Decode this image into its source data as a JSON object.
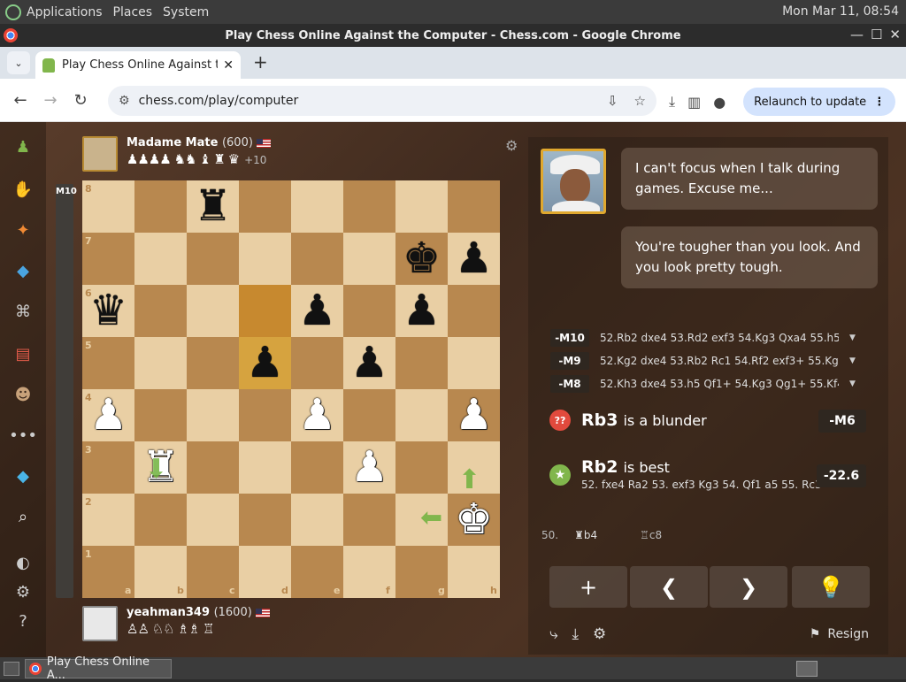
{
  "desktop": {
    "menus": [
      "Applications",
      "Places",
      "System"
    ],
    "clock": "Mon Mar 11, 08:54"
  },
  "window": {
    "title": "Play Chess Online Against the Computer - Chess.com - Google Chrome"
  },
  "browser": {
    "tab_title": "Play Chess Online Against th",
    "tab_close": "✕",
    "new_tab": "+",
    "url": "chess.com/play/computer",
    "relaunch_label": "Relaunch to update"
  },
  "top_player": {
    "name": "Madame Mate",
    "rating": "(600)",
    "captured": "♟♟♟♟ ♞♞ ♝ ♜ ♛",
    "advantage": "+10"
  },
  "bottom_player": {
    "name": "yeahman349",
    "rating": "(1600)",
    "captured": "♙♙ ♘♘ ♗♗ ♖"
  },
  "eval_bar": {
    "label": "M10"
  },
  "board": {
    "files": [
      "a",
      "b",
      "c",
      "d",
      "e",
      "f",
      "g",
      "h"
    ],
    "ranks": [
      "8",
      "7",
      "6",
      "5",
      "4",
      "3",
      "2",
      "1"
    ],
    "highlight_squares": [
      "d6",
      "d5"
    ],
    "pieces": [
      {
        "sq": "c8",
        "glyph": "♜",
        "color": "black"
      },
      {
        "sq": "g7",
        "glyph": "♚",
        "color": "black"
      },
      {
        "sq": "h7",
        "glyph": "♟",
        "color": "black"
      },
      {
        "sq": "a6",
        "glyph": "♛",
        "color": "black"
      },
      {
        "sq": "e6",
        "glyph": "♟",
        "color": "black"
      },
      {
        "sq": "g6",
        "glyph": "♟",
        "color": "black"
      },
      {
        "sq": "d5",
        "glyph": "♟",
        "color": "black"
      },
      {
        "sq": "f5",
        "glyph": "♟",
        "color": "black"
      },
      {
        "sq": "a4",
        "glyph": "♟",
        "color": "white"
      },
      {
        "sq": "e4",
        "glyph": "♟",
        "color": "white"
      },
      {
        "sq": "h4",
        "glyph": "♟",
        "color": "white"
      },
      {
        "sq": "b3",
        "glyph": "♜",
        "color": "white"
      },
      {
        "sq": "f3",
        "glyph": "♟",
        "color": "white"
      },
      {
        "sq": "h2",
        "glyph": "♚",
        "color": "white"
      }
    ]
  },
  "chat": {
    "message_1": "I can't focus when I talk during games. Excuse me...",
    "message_2": "You're tougher than you look. And you look pretty tough."
  },
  "engine_lines": [
    {
      "eval": "-M10",
      "moves": "52.Rb2 dxe4 53.Rd2 exf3 54.Kg3 Qxa4 55.h5 ...",
      "chevron": "▼"
    },
    {
      "eval": "-M9",
      "moves": "52.Kg2 dxe4 53.Rb2 Rc1 54.Rf2 exf3+ 55.Kg3 ...",
      "chevron": "▼"
    },
    {
      "eval": "-M8",
      "moves": "52.Kh3 dxe4 53.h5 Qf1+ 54.Kg3 Qg1+ 55.Kf4 ...",
      "chevron": "▼"
    }
  ],
  "classification": {
    "blunder_icon": "??",
    "blunder_move": "Rb3",
    "blunder_label": "is a blunder",
    "blunder_eval": "-M6",
    "best_icon": "★",
    "best_move": "Rb2",
    "best_label": "is best",
    "best_line": "52. fxe4 Ra2 53. exf3 Kg3 54. Qf1 a5 55. Rc3",
    "best_eval": "-22.6"
  },
  "move_row": {
    "number": "50.",
    "white_move": "♜b4",
    "black_move": "♖c8"
  },
  "controls": {
    "add": "+",
    "prev": "❮",
    "next": "❯",
    "hint": "💡"
  },
  "resign_label": "Resign",
  "taskbar": {
    "task_label": "Play Chess Online A..."
  },
  "colors": {
    "accent_green": "#81b64c",
    "blunder_red": "#e14a3d",
    "highlight": "#d6a33f"
  }
}
